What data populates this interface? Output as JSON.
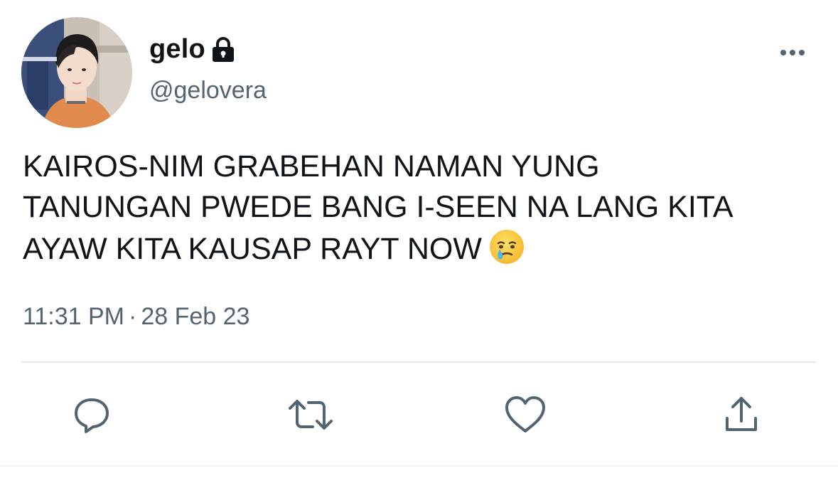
{
  "user": {
    "display_name": "gelo",
    "handle": "@gelovera",
    "protected_icon": "lock-icon",
    "avatar": "profile-photo"
  },
  "tweet": {
    "lines": [
      "KAIROS-NIM GRABEHAN NAMAN YUNG",
      "TANUNGAN PWEDE BANG I-SEEN NA LANG KITA",
      "AYAW KITA KAUSAP RAYT NOW"
    ],
    "emoji": "face-holding-back-tears-emoji",
    "time": "11:31 PM",
    "separator": "·",
    "date": "28 Feb 23"
  },
  "actions": [
    {
      "name": "reply",
      "icon": "reply-icon"
    },
    {
      "name": "retweet",
      "icon": "retweet-icon"
    },
    {
      "name": "like",
      "icon": "heart-icon"
    },
    {
      "name": "share",
      "icon": "share-icon"
    }
  ],
  "menu": {
    "icon": "more-options-icon"
  },
  "colors": {
    "text": "#0f1419",
    "secondary": "#536471",
    "divider": "#e7e9ea"
  }
}
